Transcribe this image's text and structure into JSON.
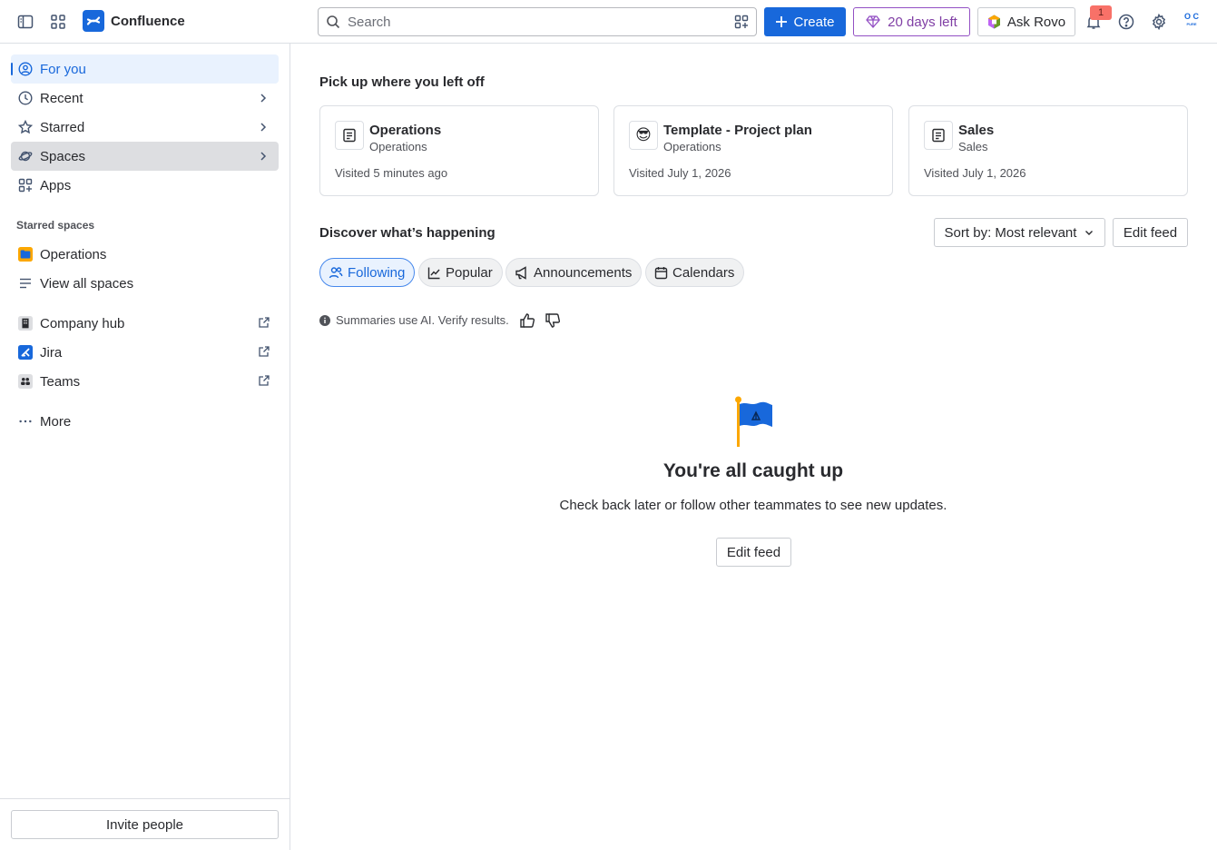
{
  "app": {
    "name": "Confluence"
  },
  "topbar": {
    "search_placeholder": "Search",
    "create_label": "Create",
    "trial_label": "20 days left",
    "rovo_label": "Ask Rovo",
    "notifications_count": "1",
    "avatar_initials_top": "O C",
    "avatar_initials_bottom": "PURE"
  },
  "sidebar": {
    "items": [
      {
        "label": "For you",
        "icon": "user-circle-icon"
      },
      {
        "label": "Recent",
        "icon": "clock-icon"
      },
      {
        "label": "Starred",
        "icon": "star-icon"
      },
      {
        "label": "Spaces",
        "icon": "planet-icon"
      },
      {
        "label": "Apps",
        "icon": "apps-icon"
      }
    ],
    "starred_spaces_label": "Starred spaces",
    "starred_spaces": [
      {
        "label": "Operations",
        "icon": "space-avatar-icon"
      }
    ],
    "view_all_label": "View all spaces",
    "external": [
      {
        "label": "Company hub",
        "icon": "building-icon"
      },
      {
        "label": "Jira",
        "icon": "jira-icon"
      },
      {
        "label": "Teams",
        "icon": "teams-icon"
      }
    ],
    "more_label": "More",
    "invite_label": "Invite people"
  },
  "main": {
    "recent_title": "Pick up where you left off",
    "recent_cards": [
      {
        "title": "Operations",
        "space": "Operations",
        "visited": "Visited 5 minutes ago",
        "icon": "page-icon"
      },
      {
        "title": "Template - Project plan",
        "space": "Operations",
        "visited": "Visited July 1, 2026",
        "icon": "sunglasses-emoji",
        "emoji": "😎"
      },
      {
        "title": "Sales",
        "space": "Sales",
        "visited": "Visited July 1, 2026",
        "icon": "page-icon"
      }
    ],
    "discover_title": "Discover what’s happening",
    "sort_label": "Sort by: Most relevant",
    "edit_feed_label": "Edit feed",
    "tabs": [
      {
        "label": "Following",
        "selected": true
      },
      {
        "label": "Popular",
        "selected": false
      },
      {
        "label": "Announcements",
        "selected": false
      },
      {
        "label": "Calendars",
        "selected": false
      }
    ],
    "ai_note": "Summaries use AI. Verify results.",
    "empty_title": "You're all caught up",
    "empty_subtitle": "Check back later or follow other teammates to see new updates.",
    "empty_button": "Edit feed"
  },
  "colors": {
    "accent": "#1868db",
    "trial": "#803fa5",
    "selected_bg": "#e9f2fe"
  }
}
